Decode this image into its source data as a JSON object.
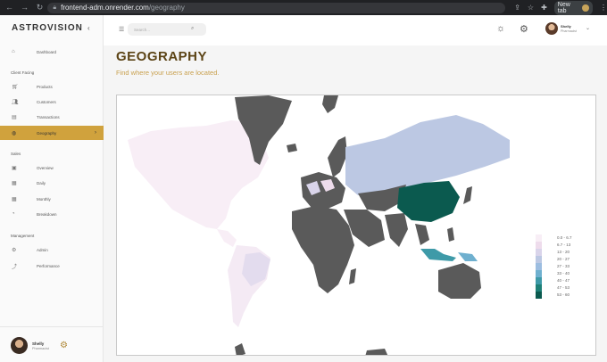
{
  "browser": {
    "url_host": "frontend-adm.onrender.com",
    "url_path": "/geography",
    "new_tab_label": "New tab"
  },
  "sidebar": {
    "brand": "ASTROVISION",
    "sections": [
      "Client Facing",
      "Sales",
      "Management"
    ],
    "items": [
      {
        "label": "Dashboard",
        "icon": "home-icon"
      },
      {
        "label": "Products",
        "icon": "cart-icon"
      },
      {
        "label": "Customers",
        "icon": "users-icon"
      },
      {
        "label": "Transactions",
        "icon": "receipt-icon"
      },
      {
        "label": "Geography",
        "icon": "globe-icon",
        "active": true
      },
      {
        "label": "Overview",
        "icon": "overview-icon"
      },
      {
        "label": "Daily",
        "icon": "calendar-day-icon"
      },
      {
        "label": "Monthly",
        "icon": "calendar-month-icon"
      },
      {
        "label": "Breakdown",
        "icon": "pie-chart-icon"
      },
      {
        "label": "Admin",
        "icon": "admin-icon"
      },
      {
        "label": "Performance",
        "icon": "trend-icon"
      }
    ],
    "profile": {
      "name": "Shelly",
      "role": "Pharmacist"
    }
  },
  "topbar": {
    "search_placeholder": "Search...",
    "user": {
      "name": "Shelly",
      "role": "Pharmacist"
    }
  },
  "page": {
    "title": "GEOGRAPHY",
    "subtitle": "Find where your users are located."
  },
  "legend": {
    "ranges": [
      "0.0 - 6.7",
      "6.7 - 13",
      "13 - 20",
      "20 - 27",
      "27 - 33",
      "33 - 40",
      "40 - 47",
      "47 - 53",
      "53 - 60"
    ],
    "colors": [
      "#f8eef6",
      "#eedcec",
      "#d9d4ea",
      "#bcc8e3",
      "#9cbde0",
      "#6fb0cf",
      "#3e9aa8",
      "#1e8077",
      "#0b5a4f"
    ]
  },
  "colors": {
    "accent": "#d0a23d",
    "title": "#5c4416",
    "no_data": "#5a5a5a"
  }
}
